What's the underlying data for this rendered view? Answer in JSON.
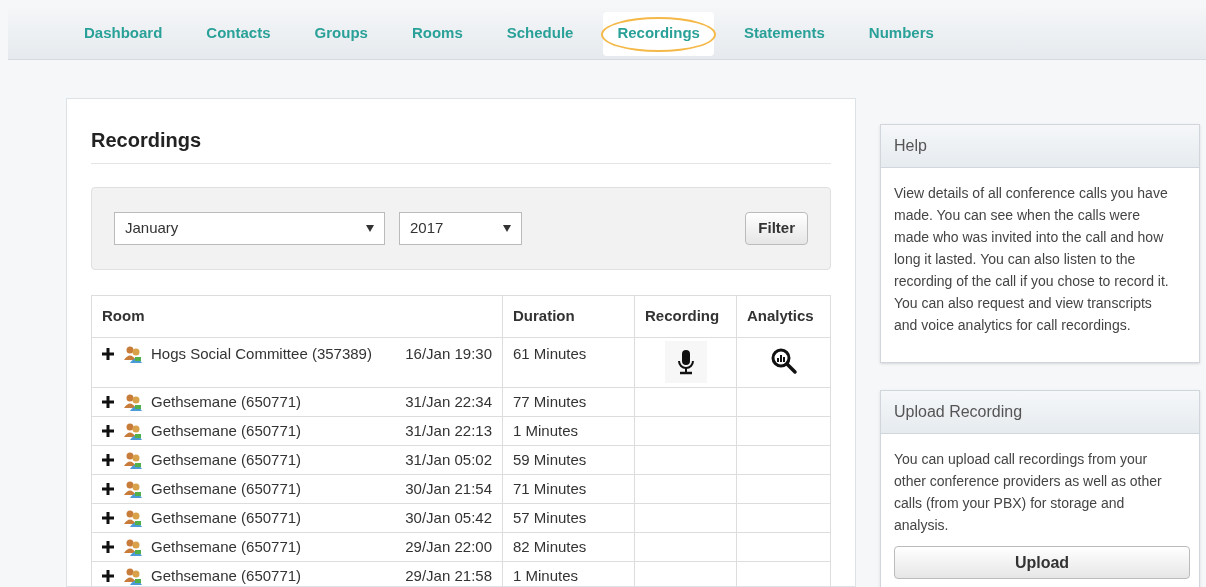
{
  "nav": [
    {
      "label": "Dashboard",
      "selected": false,
      "circled": false
    },
    {
      "label": "Contacts",
      "selected": false,
      "circled": false
    },
    {
      "label": "Groups",
      "selected": false,
      "circled": false
    },
    {
      "label": "Rooms",
      "selected": false,
      "circled": false
    },
    {
      "label": "Schedule",
      "selected": false,
      "circled": false
    },
    {
      "label": "Recordings",
      "selected": true,
      "circled": true
    },
    {
      "label": "Statements",
      "selected": false,
      "circled": false
    },
    {
      "label": "Numbers",
      "selected": false,
      "circled": false
    }
  ],
  "page_title": "Recordings",
  "filter": {
    "month": "January",
    "year": "2017",
    "button": "Filter"
  },
  "table": {
    "columns": [
      "Room",
      "Duration",
      "Recording",
      "Analytics"
    ],
    "rows": [
      {
        "room": "Hogs Social Committee (357389)",
        "date": "16/Jan 19:30",
        "duration": "61 Minutes",
        "recording": true,
        "analytics": true
      },
      {
        "room": "Gethsemane (650771)",
        "date": "31/Jan 22:34",
        "duration": "77 Minutes",
        "recording": false,
        "analytics": false
      },
      {
        "room": "Gethsemane (650771)",
        "date": "31/Jan 22:13",
        "duration": "1 Minutes",
        "recording": false,
        "analytics": false
      },
      {
        "room": "Gethsemane (650771)",
        "date": "31/Jan 05:02",
        "duration": "59 Minutes",
        "recording": false,
        "analytics": false
      },
      {
        "room": "Gethsemane (650771)",
        "date": "30/Jan 21:54",
        "duration": "71 Minutes",
        "recording": false,
        "analytics": false
      },
      {
        "room": "Gethsemane (650771)",
        "date": "30/Jan 05:42",
        "duration": "57 Minutes",
        "recording": false,
        "analytics": false
      },
      {
        "room": "Gethsemane (650771)",
        "date": "29/Jan 22:00",
        "duration": "82 Minutes",
        "recording": false,
        "analytics": false
      },
      {
        "room": "Gethsemane (650771)",
        "date": "29/Jan 21:58",
        "duration": "1 Minutes",
        "recording": false,
        "analytics": false
      }
    ]
  },
  "help": {
    "title": "Help",
    "text": "View details of all conference calls you have made. You can see when the calls were made who was invited into the call and how long it lasted. You can also listen to the recording of the call if you chose to record it. You can also request and view transcripts and voice analytics for call recordings."
  },
  "upload": {
    "title": "Upload Recording",
    "text": "You can upload call recordings from your other conference providers as well as other calls (from your PBX) for storage and analysis.",
    "button": "Upload"
  }
}
